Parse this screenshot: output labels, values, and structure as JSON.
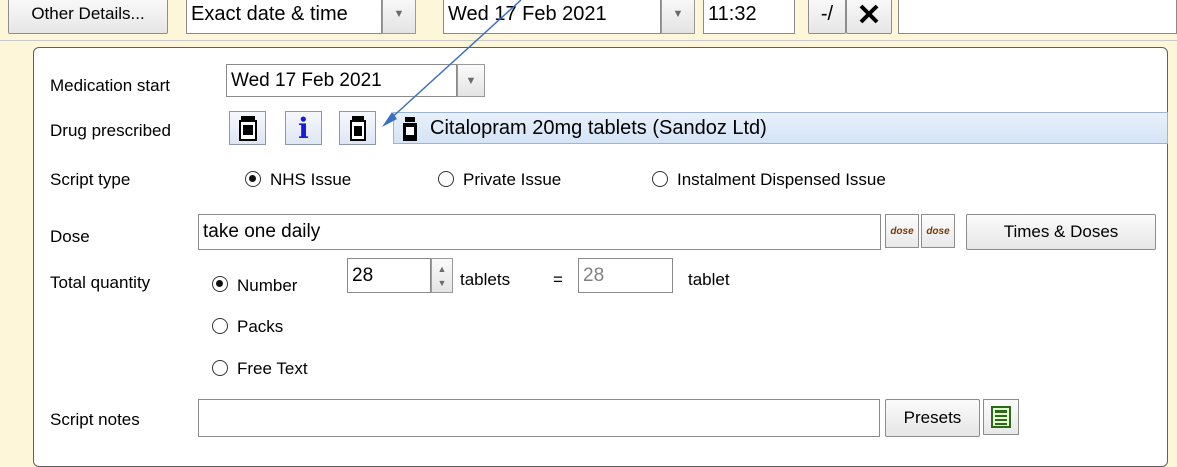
{
  "top": {
    "other_details_label": "Other Details...",
    "date_mode_value": "Exact date & time",
    "date_value": "Wed 17 Feb 2021",
    "time_value": "11:32",
    "misc_label": "-/"
  },
  "form": {
    "medication_start": {
      "label": "Medication start",
      "value": "Wed 17 Feb 2021"
    },
    "drug_prescribed": {
      "label": "Drug prescribed",
      "info_glyph": "i",
      "drug_name": "Citalopram 20mg tablets (Sandoz Ltd)"
    },
    "script_type": {
      "label": "Script type",
      "options": [
        "NHS Issue",
        "Private Issue",
        "Instalment Dispensed Issue"
      ],
      "selected": "NHS Issue"
    },
    "dose": {
      "label": "Dose",
      "value": "take one daily",
      "times_doses_label": "Times & Doses",
      "dose_icon_text_1": "dose",
      "dose_icon_text_2": "dose"
    },
    "total_quantity": {
      "label": "Total quantity",
      "options": [
        "Number",
        "Packs",
        "Free Text"
      ],
      "selected": "Number",
      "number_value": "28",
      "unit_label": "tablets",
      "equals": "=",
      "converted_value": "28",
      "converted_unit": "tablet"
    },
    "script_notes": {
      "label": "Script notes",
      "value": "",
      "presets_label": "Presets"
    }
  },
  "colors": {
    "background": "#fdf6d8",
    "drug_bar": "#d4e3f6",
    "arrow": "#3b6fc2"
  }
}
